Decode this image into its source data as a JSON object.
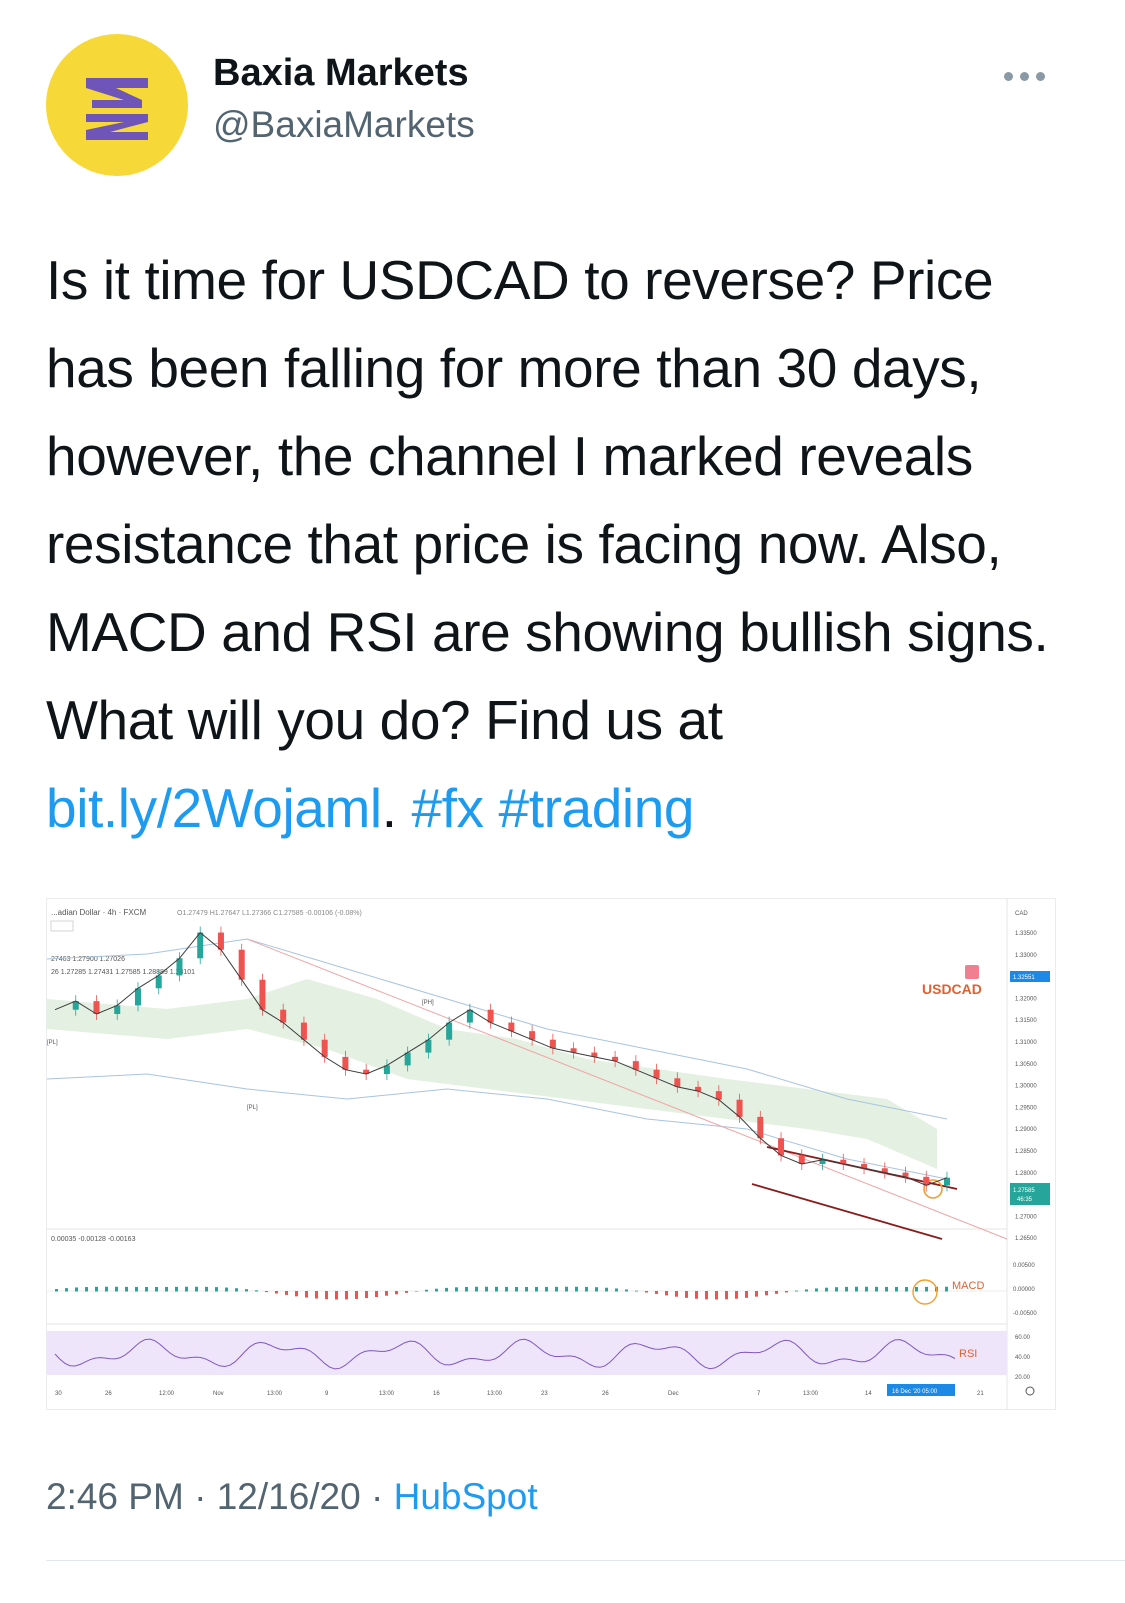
{
  "author": {
    "display_name": "Baxia Markets",
    "handle": "@BaxiaMarkets",
    "avatar_color": "#f6d938",
    "logo_color": "#6e55b7"
  },
  "tweet": {
    "text_main": "Is it time for USDCAD to reverse? Price has been falling for more than 30 days, however, the channel I marked reveals resistance that price is facing now. Also, MACD and RSI are showing bullish signs. What will you do? Find us at ",
    "link": "bit.ly/2Wojaml",
    "link_suffix": ". ",
    "hashtag_1": "#fx",
    "hashtag_2": "#trading",
    "link_color": "#1d9bf0"
  },
  "meta": {
    "time": "2:46 PM",
    "separator_1": " · ",
    "date": "12/16/20",
    "separator_2": " · ",
    "source": "HubSpot"
  },
  "chart_data": {
    "type": "line",
    "header": "...adian Dollar · 4h · FXCM",
    "ohlc_header": "O1.27479 H1.27647 L1.27366 C1.27585 -0.00106 (-0.08%)",
    "indicator_row_1": "27463 1.27900 1.27026",
    "indicator_row_2": "26 1.27285 1.27431 1.27585 1.28889 1.28101",
    "symbol_label": "USDCAD",
    "macd_label": "MACD",
    "rsi_label": "RSI",
    "macd_values_header": "0.00035 -0.00128 -0.00163",
    "currency_label": "CAD",
    "current_price_tag": "1.32551",
    "last_price_tag": "1.27585",
    "price_countdown": "46:35",
    "date_tag": "16 Dec '20 05:00",
    "pivot_labels": [
      "[PL]",
      "[PH]",
      "[PL]"
    ],
    "price_axis_ticks": [
      "1.33500",
      "1.33000",
      "1.32500",
      "1.32000",
      "1.31500",
      "1.31000",
      "1.30500",
      "1.30000",
      "1.29500",
      "1.29000",
      "1.28500",
      "1.28000",
      "1.27500",
      "1.27000",
      "1.26500"
    ],
    "macd_axis_ticks": [
      "0.00500",
      "0.00000",
      "-0.00500"
    ],
    "rsi_axis_ticks": [
      "60.00",
      "40.00",
      "20.00"
    ],
    "x_ticks": [
      "30",
      "26",
      "12:00",
      "Nov",
      "13:00",
      "9",
      "13:00",
      "16",
      "13:00",
      "23",
      "26",
      "Dec",
      "7",
      "13:00",
      "14",
      "21"
    ],
    "price_series": [
      1.315,
      1.317,
      1.314,
      1.316,
      1.32,
      1.323,
      1.327,
      1.333,
      1.329,
      1.322,
      1.315,
      1.312,
      1.308,
      1.304,
      1.301,
      1.3,
      1.302,
      1.305,
      1.308,
      1.312,
      1.315,
      1.312,
      1.31,
      1.308,
      1.306,
      1.305,
      1.304,
      1.303,
      1.301,
      1.299,
      1.297,
      1.296,
      1.294,
      1.29,
      1.285,
      1.281,
      1.279,
      1.28,
      1.279,
      1.278,
      1.277,
      1.276,
      1.274,
      1.2758
    ],
    "channel": {
      "upper": [
        1.287,
        1.277
      ],
      "lower": [
        1.28,
        1.269
      ]
    },
    "up_color": "#26a69a",
    "down_color": "#ef5350",
    "annotation_color": "#8b1a1a"
  }
}
